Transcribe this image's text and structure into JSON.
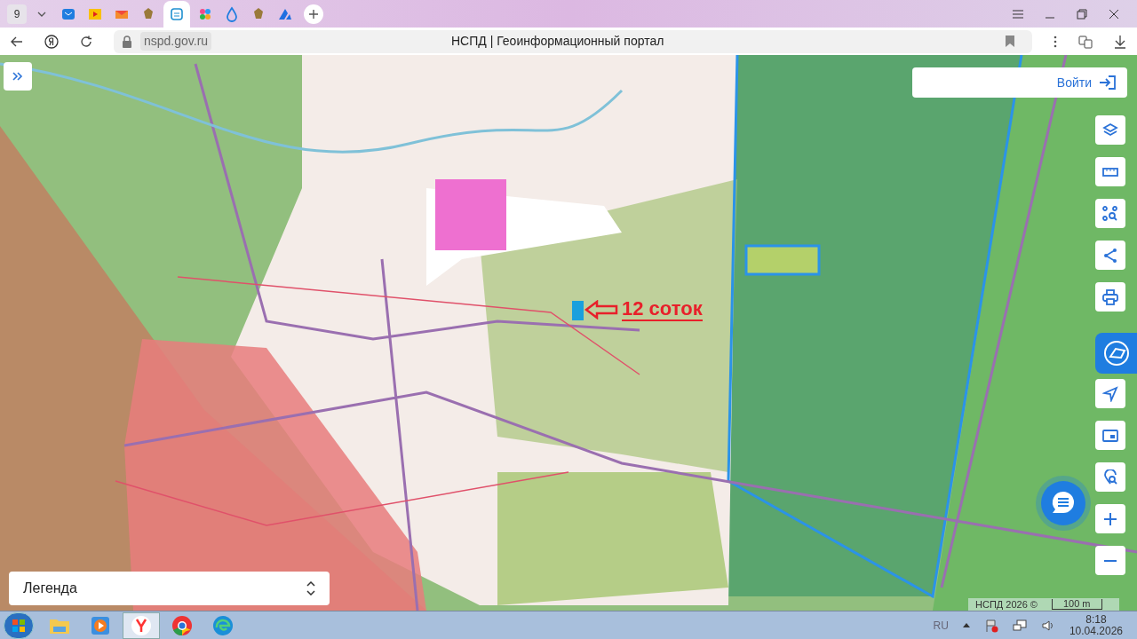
{
  "browser": {
    "tab_counter": "9",
    "tabs": [
      {
        "kind": "mail",
        "selected": false
      },
      {
        "kind": "video",
        "selected": false
      },
      {
        "kind": "envelope",
        "selected": false
      },
      {
        "kind": "emblem",
        "selected": false
      },
      {
        "kind": "portal",
        "selected": true
      },
      {
        "kind": "dots",
        "selected": false
      },
      {
        "kind": "drop",
        "selected": false
      },
      {
        "kind": "emblem",
        "selected": false
      },
      {
        "kind": "logo",
        "selected": false
      }
    ],
    "address": "nspd.gov.ru",
    "page_title": "НСПД | Геоинформационный портал"
  },
  "map": {
    "login_button": "Войти",
    "annotation": "12 соток",
    "legend": "Легенда",
    "attribution": "НСПД 2026 ©",
    "scale": "100 m"
  },
  "taskbar": {
    "apps": [
      {
        "kind": "folder",
        "selected": false
      },
      {
        "kind": "player",
        "selected": false
      },
      {
        "kind": "yandex",
        "selected": true
      },
      {
        "kind": "chrome",
        "selected": false
      },
      {
        "kind": "edge",
        "selected": false
      }
    ],
    "language": "RU",
    "time": "8:18",
    "date": "10.04.2026"
  }
}
